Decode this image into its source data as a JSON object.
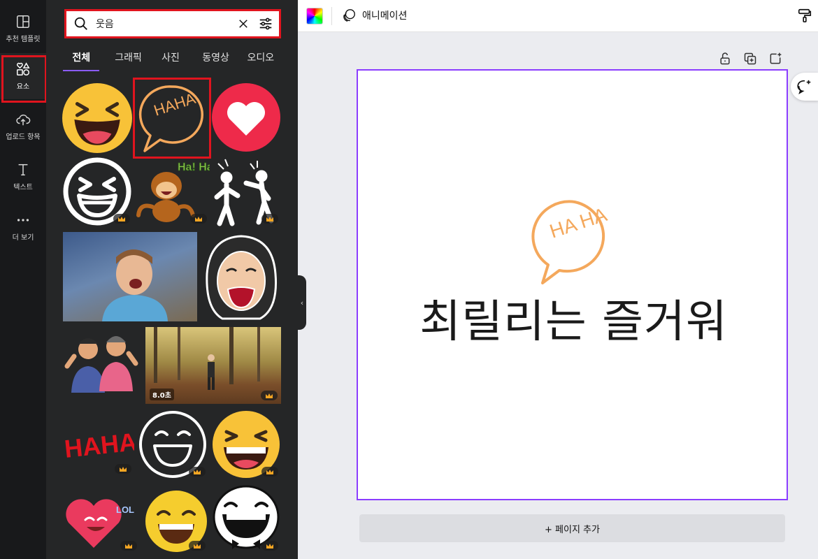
{
  "rail": {
    "items": [
      {
        "label": "추천 템플릿",
        "icon": "template-icon"
      },
      {
        "label": "요소",
        "icon": "elements-icon"
      },
      {
        "label": "업로드 항목",
        "icon": "upload-cloud-icon"
      },
      {
        "label": "텍스트",
        "icon": "text-icon"
      },
      {
        "label": "더 보기",
        "icon": "more-dots-icon"
      }
    ],
    "active_index": 1
  },
  "search": {
    "value": "웃음",
    "placeholder": ""
  },
  "tabs": [
    {
      "label": "전체",
      "active": true
    },
    {
      "label": "그래픽",
      "active": false
    },
    {
      "label": "사진",
      "active": false
    },
    {
      "label": "동영상",
      "active": false
    },
    {
      "label": "오디오",
      "active": false
    }
  ],
  "results": {
    "video_duration": "8.0초",
    "haha_text": "HAHA",
    "monkey_text": "Ha! Ha!",
    "sticker_text": "LOL"
  },
  "topbar": {
    "animation_label": "애니메이션"
  },
  "canvas": {
    "text": "최릴리는 즐거워",
    "graphic_text": "HA HA",
    "graphic_color": "#f4a85c",
    "border_color": "#8b3dff"
  },
  "add_page": {
    "label": "+ 페이지 추가"
  },
  "colors": {
    "highlight": "#e0141e",
    "accent": "#8b5cf6",
    "panel_bg": "#252627",
    "rail_bg": "#18191b"
  }
}
